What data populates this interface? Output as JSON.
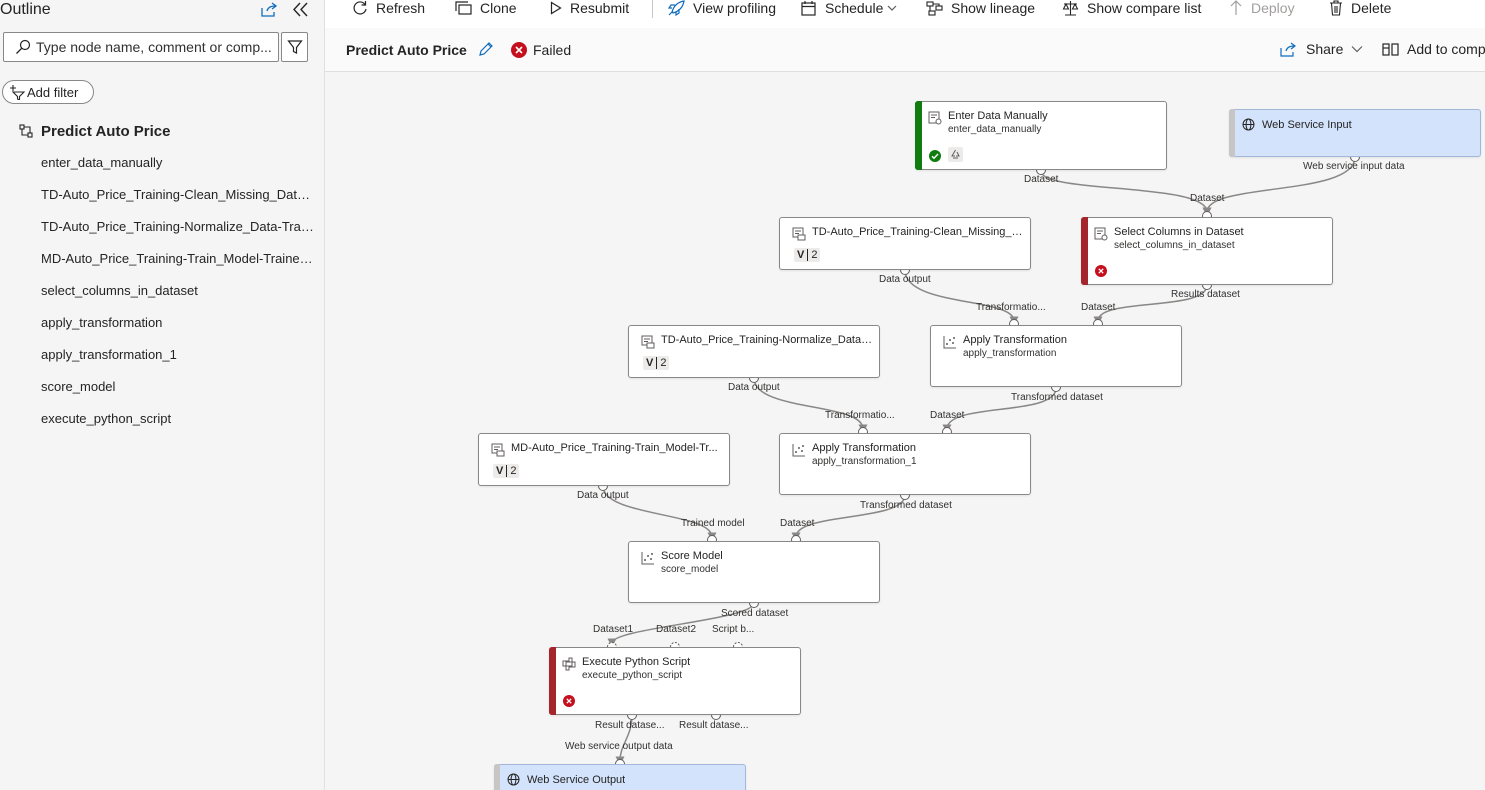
{
  "sidebar": {
    "title": "Outline",
    "search_placeholder": "Type node name, comment or comp...",
    "add_filter": "Add filter",
    "pipeline_name": "Predict Auto Price",
    "items": [
      "enter_data_manually",
      "TD-Auto_Price_Training-Clean_Missing_Data-Tr...",
      "TD-Auto_Price_Training-Normalize_Data-Transfor...",
      "MD-Auto_Price_Training-Train_Model-Trained_m...",
      "select_columns_in_dataset",
      "apply_transformation",
      "apply_transformation_1",
      "score_model",
      "execute_python_script"
    ]
  },
  "toolbar": {
    "refresh": "Refresh",
    "clone": "Clone",
    "resubmit": "Resubmit",
    "view_profiling": "View profiling",
    "schedule": "Schedule",
    "show_lineage": "Show lineage",
    "show_compare_list": "Show compare list",
    "deploy": "Deploy",
    "delete": "Delete"
  },
  "header": {
    "title": "Predict Auto Price",
    "status": "Failed",
    "share": "Share",
    "add_to_compare": "Add to comp"
  },
  "nodes": {
    "enter_data": {
      "title": "Enter Data Manually",
      "sub": "enter_data_manually",
      "out_port": "Dataset"
    },
    "web_input": {
      "title": "Web Service Input",
      "out_port": "Web service input data"
    },
    "td_clean": {
      "title": "TD-Auto_Price_Training-Clean_Missing_D...",
      "version": "2",
      "out_port": "Data output"
    },
    "select_cols": {
      "title": "Select Columns in Dataset",
      "sub": "select_columns_in_dataset",
      "in_port": "Dataset",
      "out_port": "Results dataset"
    },
    "td_normalize": {
      "title": "TD-Auto_Price_Training-Normalize_Data-...",
      "version": "2",
      "out_port": "Data output"
    },
    "apply_1": {
      "title": "Apply Transformation",
      "sub": "apply_transformation",
      "in_port_1": "Transformatio...",
      "in_port_2": "Dataset",
      "out_port": "Transformed dataset"
    },
    "md_train": {
      "title": "MD-Auto_Price_Training-Train_Model-Tr...",
      "version": "2",
      "out_port": "Data output"
    },
    "apply_2": {
      "title": "Apply Transformation",
      "sub": "apply_transformation_1",
      "in_port_1": "Transformatio...",
      "in_port_2": "Dataset",
      "out_port": "Transformed dataset"
    },
    "score": {
      "title": "Score Model",
      "sub": "score_model",
      "in_port_1": "Trained model",
      "in_port_2": "Dataset",
      "out_port": "Scored dataset"
    },
    "python": {
      "title": "Execute Python Script",
      "sub": "execute_python_script",
      "in_port_1": "Dataset1",
      "in_port_2": "Dataset2",
      "in_port_3": "Script b...",
      "out_port_1": "Result datase...",
      "out_port_2": "Result datase..."
    },
    "web_output": {
      "title": "Web Service Output",
      "in_port": "Web service output data"
    }
  },
  "colors": {
    "success": "#107c10",
    "failed": "#c50f1f",
    "accent": "#0f6cbd",
    "web_service_node": "#d3e3fb"
  }
}
